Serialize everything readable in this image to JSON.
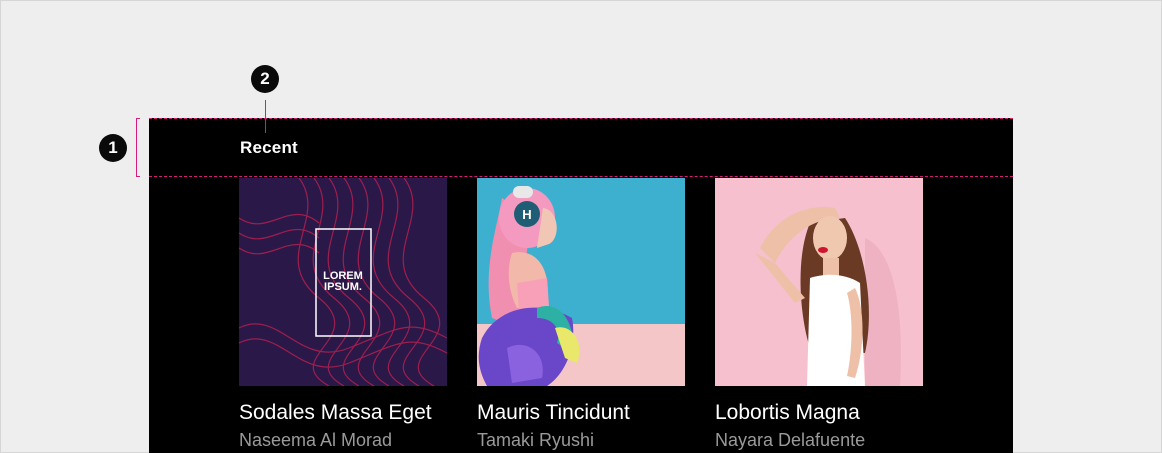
{
  "section": {
    "title": "Recent"
  },
  "annotations": {
    "marker_1": "1",
    "marker_2": "2"
  },
  "cards": [
    {
      "title": "Sodales Massa Eget",
      "subtitle": "Naseema Al Morad",
      "cover_line1": "LOREM",
      "cover_line2": "IPSUM."
    },
    {
      "title": "Mauris Tincidunt",
      "subtitle": "Tamaki Ryushi",
      "headphone_letter": "H"
    },
    {
      "title": "Lobortis Magna",
      "subtitle": "Nayara Delafuente"
    }
  ],
  "colors": {
    "panel": "#000000",
    "accent": "#d81b7a",
    "background": "#eeeeee",
    "subtitle": "#9a9a9a"
  }
}
